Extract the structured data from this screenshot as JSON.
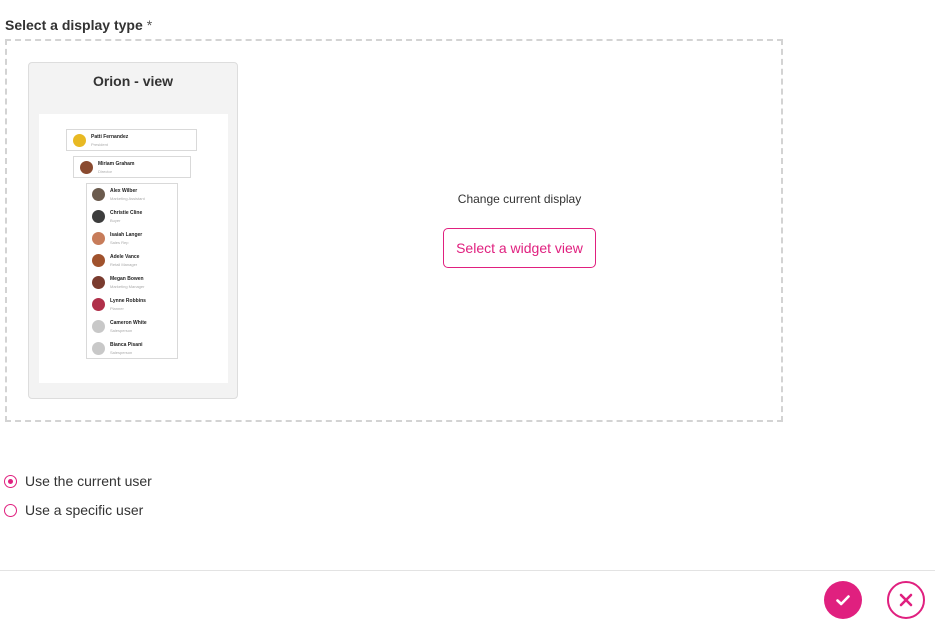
{
  "display_type": {
    "label": "Select a display type",
    "required_mark": "*"
  },
  "card": {
    "title": "Orion - view",
    "org_preview": {
      "top": [
        {
          "name": "Patti Fernandez",
          "role": "President"
        },
        {
          "name": "Miriam Graham",
          "role": "Director"
        }
      ],
      "reports": [
        {
          "name": "Alex Wilber",
          "role": "Marketing Assistant"
        },
        {
          "name": "Christie Cline",
          "role": "Buyer"
        },
        {
          "name": "Isaiah Langer",
          "role": "Sales Rep"
        },
        {
          "name": "Adele Vance",
          "role": "Retail Manager"
        },
        {
          "name": "Megan Bowen",
          "role": "Marketing Manager"
        },
        {
          "name": "Lynne Robbins",
          "role": "Planner"
        },
        {
          "name": "Cameron White",
          "role": "Salesperson"
        },
        {
          "name": "Bianca Pisani",
          "role": "Salesperson"
        }
      ]
    }
  },
  "change_display": {
    "text": "Change current display",
    "button_label": "Select a widget view"
  },
  "user_options": [
    {
      "label": "Use the current user",
      "selected": true
    },
    {
      "label": "Use a specific user",
      "selected": false
    }
  ],
  "footer": {
    "confirm_icon": "check-icon",
    "cancel_icon": "close-icon"
  },
  "colors": {
    "accent": "#e0207f",
    "dashed_border": "#d3d3d3",
    "card_background": "#f3f3f3"
  }
}
